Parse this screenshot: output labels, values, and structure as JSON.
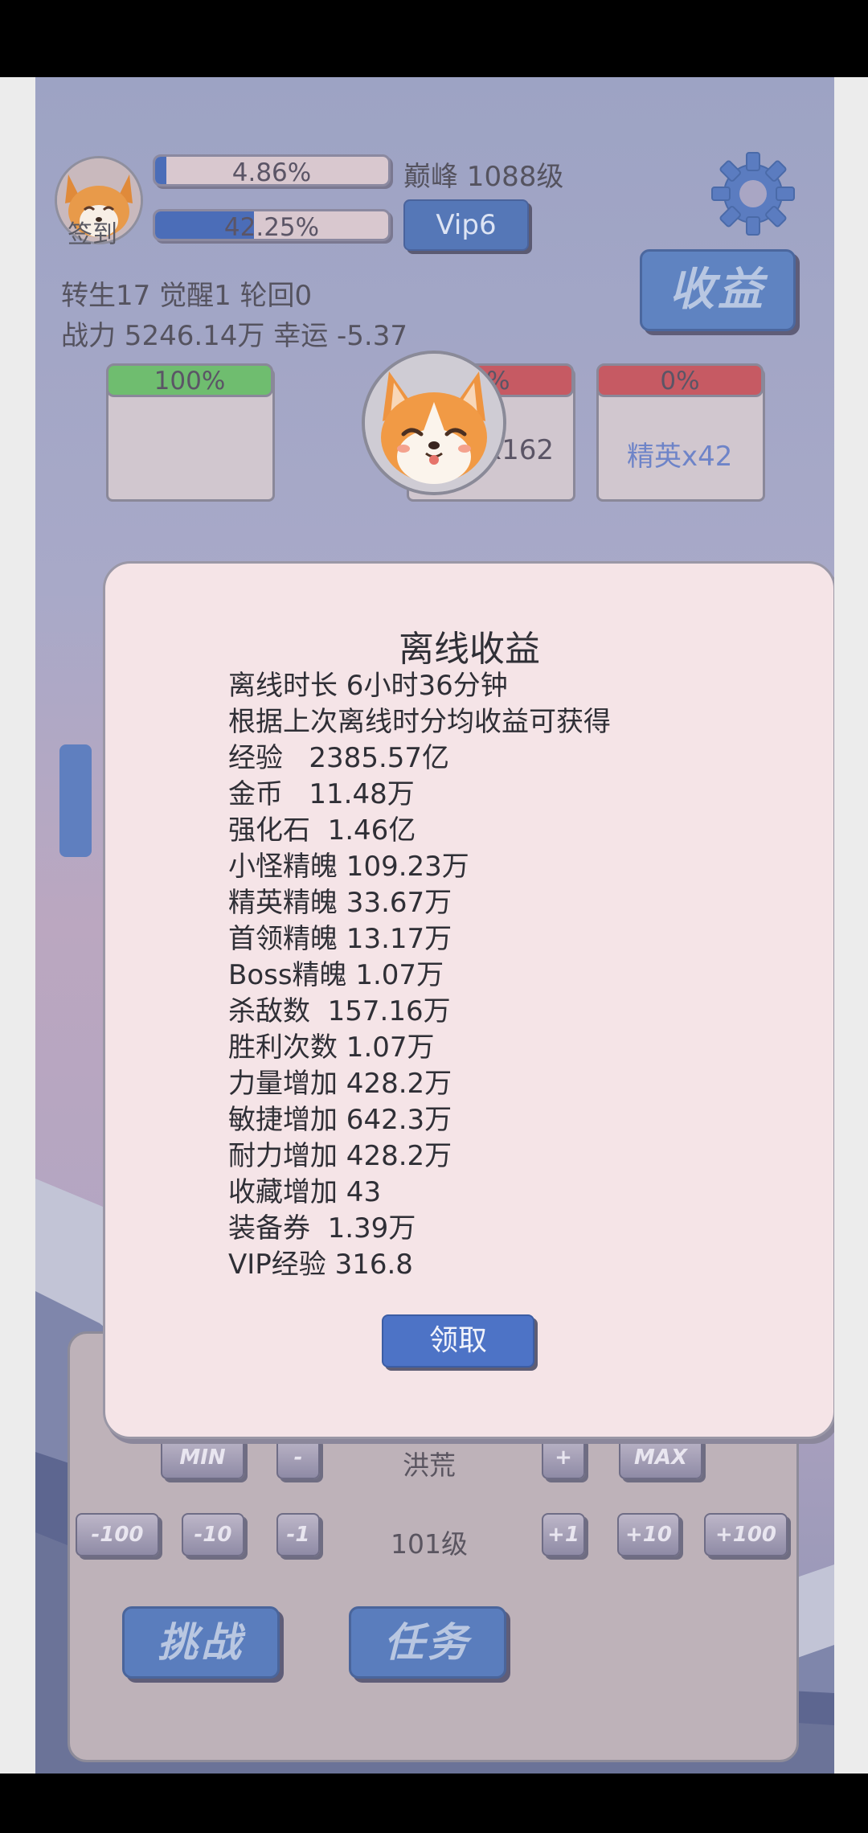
{
  "header": {
    "signin_label": "签到",
    "level_progress": 4.86,
    "level_progress_text": "4.86%",
    "peak_level_text": "巅峰 1088级",
    "vip_progress": 42.25,
    "vip_progress_text": "42.25%",
    "vip_label": "Vip6",
    "income_label": "收益",
    "rebirth_line": "转生17 觉醒1 轮回0",
    "power_line": "战力 5246.14万  幸运 -5.37"
  },
  "slots": [
    {
      "tag": "100%",
      "label": "",
      "tag_color": "#6fbd6f"
    },
    {
      "tag": "0%",
      "label": "x162",
      "tag_color": "#c65a63"
    },
    {
      "tag": "0%",
      "label": "精英x42",
      "tag_color": "#c65a63"
    }
  ],
  "panel": {
    "min_label": "MIN",
    "minus_label": "-",
    "realm_label": "洪荒",
    "plus_label": "+",
    "max_label": "MAX",
    "m100_label": "-100",
    "m10_label": "-10",
    "m1_label": "-1",
    "level_label": "101级",
    "p1_label": "+1",
    "p10_label": "+10",
    "p100_label": "+100",
    "challenge_label": "挑战",
    "task_label": "任务"
  },
  "modal": {
    "title": "离线收益",
    "lines": [
      "离线时长 6小时36分钟",
      "根据上次离线时分均收益可获得",
      "经验   2385.57亿",
      "金币   11.48万",
      "强化石  1.46亿",
      "小怪精魄 109.23万",
      "精英精魄 33.67万",
      "首领精魄 13.17万",
      "Boss精魄 1.07万",
      "杀敌数  157.16万",
      "胜利次数 1.07万",
      "力量增加 428.2万",
      "敏捷增加 642.3万",
      "耐力增加 428.2万",
      "收藏增加 43",
      "装备券  1.39万",
      "VIP经验 316.8"
    ],
    "claim_label": "领取"
  },
  "colors": {
    "accent_blue": "#4d73c6",
    "modal_bg": "#f5e4e7",
    "progress_green": "#6fbd6f",
    "progress_red": "#c65a63"
  }
}
